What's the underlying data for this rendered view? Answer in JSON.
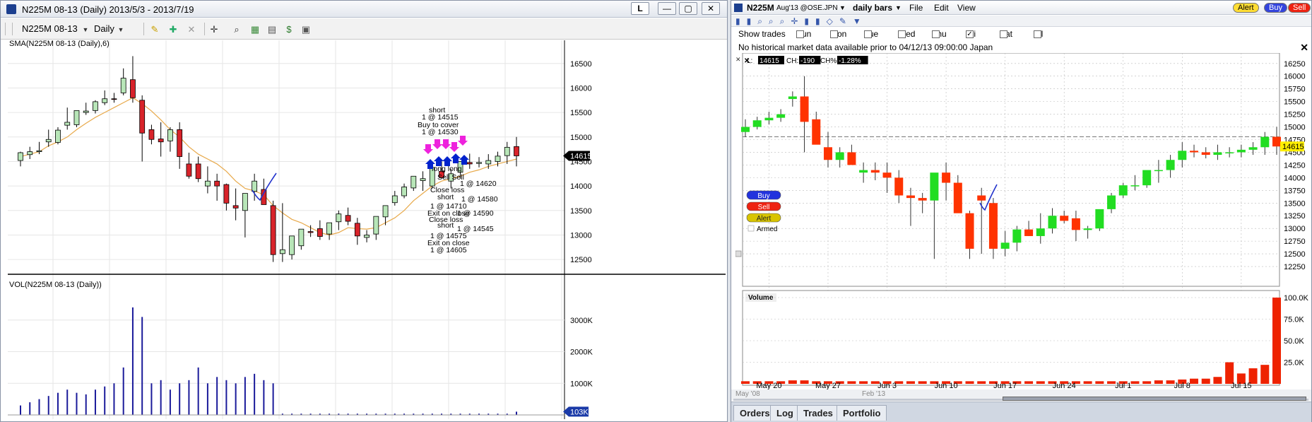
{
  "left_window": {
    "title": "N225M 08-13 (Daily)  2013/5/3 - 2013/7/19",
    "controls": {
      "l": "L",
      "min": "—",
      "max": "▢",
      "close": "✕"
    },
    "toolbar": {
      "symbol": "N225M 08-13",
      "period": "Daily"
    },
    "price_panel": {
      "label": "SMA(N225M 08-13 (Daily),6)",
      "yticks": [
        "16500",
        "16000",
        "15500",
        "15000",
        "14500",
        "14000",
        "13500",
        "13000",
        "12500"
      ],
      "last_price": "14615",
      "annotations": [
        "short",
        "1 @ 14515",
        "Buy to cover",
        "1 @ 14530",
        "long long",
        "Sell Sell",
        "1 @ 14620",
        "Close loss",
        "short",
        "1 @ 14580",
        "1 @ 14710",
        "Exit on close",
        "1 @ 14590",
        "Close loss",
        "short",
        "1 @ 14545",
        "1 @ 14575",
        "Exit on close",
        "1 @ 14605"
      ]
    },
    "volume_panel": {
      "label": "VOL(N225M 08-13 (Daily))",
      "yticks": [
        "3000K",
        "2000K",
        "1000K"
      ],
      "last_volume": "103K"
    }
  },
  "right_window": {
    "title": {
      "symbol": "N225M",
      "contract": "Aug'13 @OSE.JPN",
      "period": "daily bars",
      "menu_file": "File",
      "menu_edit": "Edit",
      "menu_view": "View"
    },
    "buttons": {
      "alert": "Alert",
      "buy": "Buy",
      "sell": "Sell"
    },
    "show_trades": "Show trades",
    "days": [
      {
        "label": "Sun",
        "checked": false
      },
      {
        "label": "Mon",
        "checked": false
      },
      {
        "label": "Tue",
        "checked": false
      },
      {
        "label": "Wed",
        "checked": false
      },
      {
        "label": "Thu",
        "checked": false
      },
      {
        "label": "Fri",
        "checked": true
      },
      {
        "label": "Sat",
        "checked": false
      },
      {
        "label": "All",
        "checked": false
      }
    ],
    "message": "No historical market data available prior to 04/12/13 09:00:00 Japan",
    "readout": {
      "l_label": "L:",
      "l_value": "14615",
      "ch_label": "CH:",
      "ch_value": "-190",
      "chp_label": "CH%:",
      "chp_value": "-1.28%"
    },
    "order_buttons": {
      "buy": "Buy",
      "sell": "Sell",
      "alert": "Alert",
      "armed": "Armed"
    },
    "yticks": [
      "16250",
      "16000",
      "15750",
      "15500",
      "15250",
      "15000",
      "14750",
      "14500",
      "14250",
      "14000",
      "13750",
      "13500",
      "13250",
      "13000",
      "12750",
      "12500",
      "12250"
    ],
    "last_price": "14615",
    "volume_label": "Volume",
    "vol_ticks": [
      "100.0K",
      "75.0K",
      "50.0K",
      "25.0K"
    ],
    "xlabels": [
      "May 20",
      "May 27",
      "Jun 3",
      "Jun 10",
      "Jun 17",
      "Jun 24",
      "Jul 1",
      "Jul 8",
      "Jul 15"
    ],
    "nav_labels": [
      "May '08",
      "Feb '13"
    ],
    "tabs": [
      "Orders",
      "Log",
      "Trades",
      "Portfolio"
    ]
  },
  "colors": {
    "up_left": "#b8e6b8",
    "down_left": "#d8232a",
    "up_right": "#22dd22",
    "down_right": "#ff3300",
    "sma": "#e8a94a",
    "volume_left": "#1a1a9a",
    "volume_right": "#ee2200",
    "buy_arrow": "#0022cc",
    "sell_arrow": "#ee22dd"
  },
  "chart_data": [
    {
      "type": "candlestick",
      "title": "SMA(N225M 08-13 (Daily),6)",
      "ylim": [
        12300,
        16800
      ],
      "x": [
        "5/3",
        "5/7",
        "5/8",
        "5/9",
        "5/10",
        "5/13",
        "5/14",
        "5/15",
        "5/16",
        "5/17",
        "5/20",
        "5/21",
        "5/22",
        "5/23",
        "5/24",
        "5/27",
        "5/28",
        "5/29",
        "5/30",
        "5/31",
        "6/3",
        "6/4",
        "6/5",
        "6/6",
        "6/7",
        "6/10",
        "6/11",
        "6/12",
        "6/13",
        "6/14",
        "6/17",
        "6/18",
        "6/19",
        "6/20",
        "6/21",
        "6/24",
        "6/25",
        "6/26",
        "6/27",
        "6/28",
        "7/1",
        "7/2",
        "7/3",
        "7/4",
        "7/5",
        "7/8",
        "7/9",
        "7/10",
        "7/11",
        "7/12",
        "7/16",
        "7/17",
        "7/18",
        "7/19"
      ],
      "open": [
        14520,
        14640,
        14700,
        14900,
        14890,
        15240,
        15250,
        15500,
        15540,
        15700,
        15780,
        15900,
        16170,
        15750,
        15150,
        14960,
        14920,
        15150,
        14450,
        14450,
        14000,
        14100,
        14030,
        13600,
        13500,
        13890,
        13930,
        13600,
        12620,
        12600,
        12780,
        13070,
        13130,
        13020,
        13270,
        13400,
        13240,
        12950,
        13020,
        13370,
        13660,
        13800,
        13960,
        14110,
        14000,
        14300,
        14100,
        14280,
        14480,
        14460,
        14450,
        14500,
        14620,
        14805
      ],
      "high": [
        14700,
        14800,
        14900,
        15150,
        15200,
        15600,
        15520,
        15700,
        15750,
        15950,
        15900,
        16400,
        16650,
        15850,
        15250,
        15300,
        15200,
        15300,
        14680,
        14600,
        14400,
        14250,
        14050,
        13950,
        13700,
        14250,
        14150,
        13700,
        13650,
        12900,
        13000,
        13200,
        13300,
        13250,
        13500,
        13560,
        13350,
        13100,
        13200,
        13600,
        13900,
        14050,
        14200,
        14300,
        14250,
        14500,
        14350,
        14500,
        14660,
        14590,
        14650,
        14700,
        14900,
        15000
      ],
      "low": [
        14400,
        14550,
        14650,
        14800,
        14850,
        15150,
        15200,
        15450,
        15480,
        15650,
        15700,
        15850,
        15700,
        14500,
        14850,
        14600,
        14700,
        14350,
        14150,
        14080,
        13850,
        13700,
        13500,
        13300,
        12950,
        13700,
        13700,
        12450,
        12450,
        12500,
        12700,
        12960,
        12900,
        12900,
        13100,
        13200,
        12800,
        12850,
        12900,
        13200,
        13600,
        13750,
        13900,
        13900,
        13950,
        14150,
        13950,
        14150,
        14350,
        14380,
        14350,
        14400,
        14450,
        14400
      ],
      "close": [
        14680,
        14700,
        14720,
        14950,
        15140,
        15300,
        15540,
        15530,
        15720,
        15780,
        15770,
        16200,
        15800,
        15080,
        14950,
        14900,
        15150,
        14600,
        14200,
        14150,
        14100,
        14000,
        13650,
        13550,
        13850,
        14100,
        13620,
        12600,
        12700,
        12980,
        13120,
        13050,
        12970,
        13250,
        13430,
        13280,
        12980,
        13000,
        13380,
        13600,
        13800,
        13980,
        14200,
        14150,
        14380,
        14170,
        14250,
        14500,
        14450,
        14480,
        14520,
        14610,
        14790,
        14615
      ],
      "sma": [
        14600,
        14650,
        14700,
        14820,
        14900,
        15000,
        15150,
        15280,
        15400,
        15500,
        15600,
        15700,
        15800,
        15680,
        15530,
        15350,
        15150,
        15000,
        14800,
        14650,
        14550,
        14450,
        14300,
        14100,
        13950,
        13900,
        13820,
        13600,
        13450,
        13320,
        13250,
        13150,
        13050,
        13000,
        13050,
        13150,
        13130,
        13120,
        13150,
        13250,
        13350,
        13500,
        13700,
        13850,
        14000,
        14100,
        14150,
        14200,
        14280,
        14330,
        14400,
        14450,
        14500,
        14550
      ],
      "volume_panel": {
        "title": "VOL(N225M 08-13 (Daily))",
        "ylim": [
          0,
          3800
        ],
        "values": [
          300,
          400,
          500,
          600,
          700,
          800,
          700,
          650,
          800,
          900,
          1000,
          1500,
          3400,
          3100,
          1000,
          1100,
          800,
          1000,
          1100,
          1500,
          1000,
          1200,
          1100,
          1000,
          1200,
          1300,
          1100,
          1000,
          40,
          40,
          40,
          40,
          40,
          40,
          40,
          40,
          40,
          40,
          40,
          40,
          40,
          40,
          40,
          40,
          40,
          40,
          40,
          40,
          40,
          40,
          40,
          40,
          40,
          103
        ]
      }
    },
    {
      "type": "candlestick",
      "ylim": [
        12000,
        16400
      ],
      "x": [
        "5/16",
        "5/17",
        "5/20",
        "5/21",
        "5/22",
        "5/23",
        "5/24",
        "5/27",
        "5/28",
        "5/29",
        "5/30",
        "5/31",
        "6/3",
        "6/4",
        "6/5",
        "6/6",
        "6/7",
        "6/10",
        "6/11",
        "6/12",
        "6/13",
        "6/14",
        "6/17",
        "6/18",
        "6/19",
        "6/20",
        "6/21",
        "6/24",
        "6/25",
        "6/26",
        "6/27",
        "6/28",
        "7/1",
        "7/2",
        "7/3",
        "7/4",
        "7/5",
        "7/8",
        "7/9",
        "7/10",
        "7/11",
        "7/12",
        "7/16",
        "7/17",
        "7/18",
        "7/19"
      ],
      "open": [
        14900,
        15000,
        15130,
        15180,
        15550,
        15600,
        15150,
        14600,
        14350,
        14500,
        14100,
        14150,
        14100,
        14000,
        13650,
        13600,
        13550,
        14100,
        13900,
        13300,
        13650,
        13500,
        12600,
        12720,
        12980,
        12850,
        13000,
        13250,
        13200,
        12970,
        13000,
        13380,
        13650,
        13850,
        13850,
        14150,
        14150,
        14350,
        14530,
        14500,
        14450,
        14500,
        14500,
        14550,
        14600,
        14805
      ],
      "high": [
        15150,
        15200,
        15300,
        15350,
        15700,
        16000,
        15300,
        14900,
        14600,
        14650,
        14300,
        14300,
        14300,
        14150,
        13800,
        13700,
        13900,
        14300,
        14050,
        13350,
        13800,
        13600,
        12950,
        13050,
        13150,
        13300,
        13400,
        13350,
        13350,
        13050,
        13300,
        13700,
        13900,
        14050,
        14050,
        14350,
        14450,
        14700,
        14650,
        14600,
        14650,
        14600,
        14650,
        14700,
        14900,
        15000
      ],
      "low": [
        14800,
        14950,
        15050,
        15100,
        15400,
        14500,
        15000,
        14200,
        14200,
        14300,
        13900,
        13950,
        13700,
        13500,
        13050,
        13300,
        12400,
        13550,
        13400,
        12400,
        12500,
        12400,
        12450,
        12550,
        12850,
        12700,
        12900,
        13100,
        12750,
        12800,
        12950,
        13300,
        13600,
        13750,
        13800,
        13900,
        14000,
        14200,
        14400,
        14380,
        14350,
        14400,
        14400,
        14450,
        14450,
        14450
      ],
      "close": [
        15000,
        15130,
        15180,
        15250,
        15600,
        15100,
        14650,
        14350,
        14500,
        14250,
        14150,
        14100,
        14000,
        13650,
        13600,
        13550,
        14100,
        13900,
        13300,
        12600,
        13550,
        12600,
        12720,
        12980,
        12850,
        13000,
        13250,
        13150,
        12970,
        13000,
        13380,
        13650,
        13850,
        13850,
        14150,
        14150,
        14350,
        14530,
        14500,
        14450,
        14500,
        14500,
        14550,
        14600,
        14805,
        14615
      ],
      "volume_panel": {
        "title": "Volume",
        "ylim": [
          0,
          100
        ],
        "values": [
          3,
          3,
          3,
          3,
          4,
          4,
          3,
          3,
          3,
          3,
          3,
          3,
          3,
          3,
          3,
          3,
          3,
          3,
          3,
          3,
          3,
          3,
          3,
          3,
          3,
          3,
          3,
          3,
          3,
          3,
          3,
          3,
          3,
          3,
          3,
          4,
          4,
          5,
          6,
          6,
          8,
          25,
          12,
          18,
          22,
          100
        ]
      }
    }
  ]
}
